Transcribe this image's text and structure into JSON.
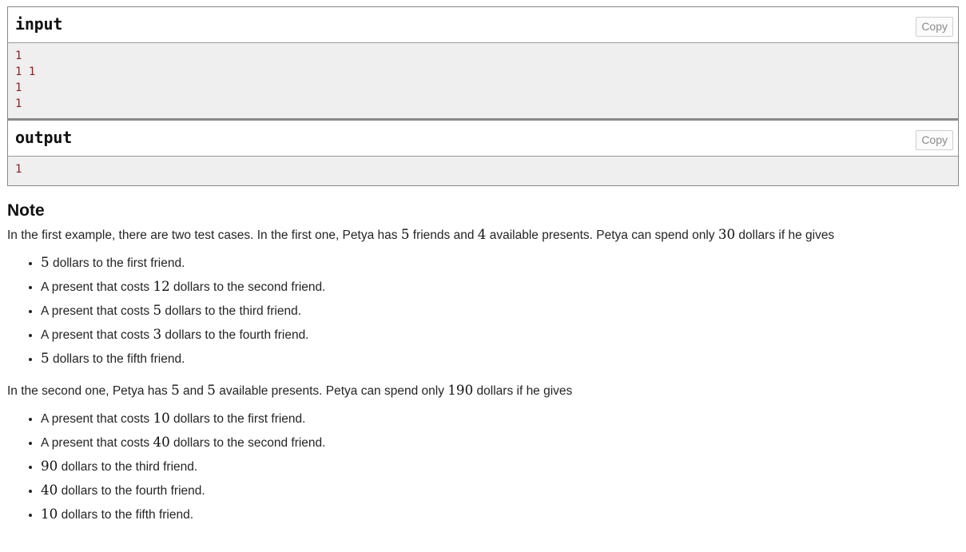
{
  "samples": [
    {
      "title": "input",
      "copy_label": "Copy",
      "content": "1\n1 1\n1\n1"
    },
    {
      "title": "output",
      "copy_label": "Copy",
      "content": "1"
    }
  ],
  "note": {
    "heading": "Note",
    "paragraph_1": {
      "part_1": "In the first example, there are two test cases. In the first one, Petya has ",
      "num_1": "5",
      "part_2": " friends and ",
      "num_2": "4",
      "part_3": " available presents. Petya can spend only ",
      "num_3": "30",
      "part_4": " dollars if he gives"
    },
    "list_1": [
      {
        "pre": "",
        "num": "5",
        "post": " dollars to the first friend."
      },
      {
        "pre": "A present that costs ",
        "num": "12",
        "post": " dollars to the second friend."
      },
      {
        "pre": "A present that costs ",
        "num": "5",
        "post": " dollars to the third friend."
      },
      {
        "pre": "A present that costs ",
        "num": "3",
        "post": " dollars to the fourth friend."
      },
      {
        "pre": "",
        "num": "5",
        "post": " dollars to the fifth friend."
      }
    ],
    "paragraph_2": {
      "part_1": "In the second one, Petya has ",
      "num_1": "5",
      "part_2": " and ",
      "num_2": "5",
      "part_3": " available presents. Petya can spend only ",
      "num_3": "190",
      "part_4": " dollars if he gives"
    },
    "list_2": [
      {
        "pre": "A present that costs ",
        "num": "10",
        "post": " dollars to the first friend."
      },
      {
        "pre": "A present that costs ",
        "num": "40",
        "post": " dollars to the second friend."
      },
      {
        "pre": "",
        "num": "90",
        "post": " dollars to the third friend."
      },
      {
        "pre": "",
        "num": "40",
        "post": " dollars to the fourth friend."
      },
      {
        "pre": "",
        "num": "10",
        "post": " dollars to the fifth friend."
      }
    ]
  },
  "colors": {
    "code_text": "#8b2020",
    "code_bg": "#efefef",
    "border": "#888888",
    "copy_border": "#cfcfcf",
    "copy_text": "#8b8b8b"
  }
}
